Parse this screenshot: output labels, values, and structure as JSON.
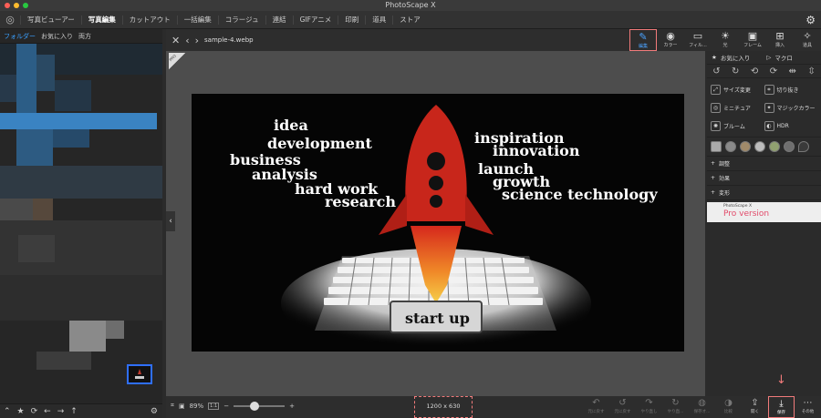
{
  "app": {
    "title": "PhotoScape X"
  },
  "menu": [
    "写真ビューアー",
    "写真編集",
    "カットアウト",
    "一括編集",
    "コラージュ",
    "連結",
    "GIFアニメ",
    "印刷",
    "道具",
    "ストア"
  ],
  "menu_active_index": 1,
  "left": {
    "tabs": [
      "フォルダー",
      "お気に入り",
      "両方"
    ]
  },
  "center": {
    "filename": "sample-4.webp",
    "pro_label": "PRO"
  },
  "toolbar": [
    {
      "label": "編集",
      "icon": "edit-icon"
    },
    {
      "label": "カラー",
      "icon": "color-icon"
    },
    {
      "label": "フィル...",
      "icon": "film-icon"
    },
    {
      "label": "光",
      "icon": "light-icon"
    },
    {
      "label": "フレーム",
      "icon": "frame-icon"
    },
    {
      "label": "挿入",
      "icon": "insert-icon"
    },
    {
      "label": "道具",
      "icon": "tools-icon"
    }
  ],
  "right_panel": {
    "favorites": "お気に入り",
    "macro": "マクロ",
    "tools": [
      "サイズ変更",
      "切り抜き",
      "ミニチュア",
      "マジックカラー",
      "ブルーム",
      "HDR"
    ],
    "sections": [
      "調整",
      "効果",
      "変形"
    ],
    "pro_banner_small": "PhotoScape X",
    "pro_banner_big": "Pro version"
  },
  "image_words": {
    "left": [
      "idea",
      "development",
      "business",
      "analysis",
      "hard work",
      "research"
    ],
    "right": [
      "inspiration",
      "innovation",
      "launch",
      "growth",
      "science technology"
    ],
    "button": "start up"
  },
  "bottom": {
    "zoom": "89%",
    "zoom_ratio": "1:1",
    "dimensions": "1200 x 630",
    "actions": [
      {
        "label": "元に戻す",
        "icon": "undo-icon"
      },
      {
        "label": "元に戻す",
        "icon": "undo-all-icon"
      },
      {
        "label": "やり直し",
        "icon": "redo-icon"
      },
      {
        "label": "やり直...",
        "icon": "redo-all-icon"
      },
      {
        "label": "保存オ...",
        "icon": "save-original-icon"
      },
      {
        "label": "比較",
        "icon": "compare-icon"
      },
      {
        "label": "開く",
        "icon": "open-icon"
      },
      {
        "label": "保存",
        "icon": "save-icon"
      },
      {
        "label": "その他",
        "icon": "more-icon"
      }
    ]
  },
  "colors": {
    "accent": "#3aa0ff",
    "highlight": "#f27b7b",
    "background": "#2b2b2b"
  }
}
